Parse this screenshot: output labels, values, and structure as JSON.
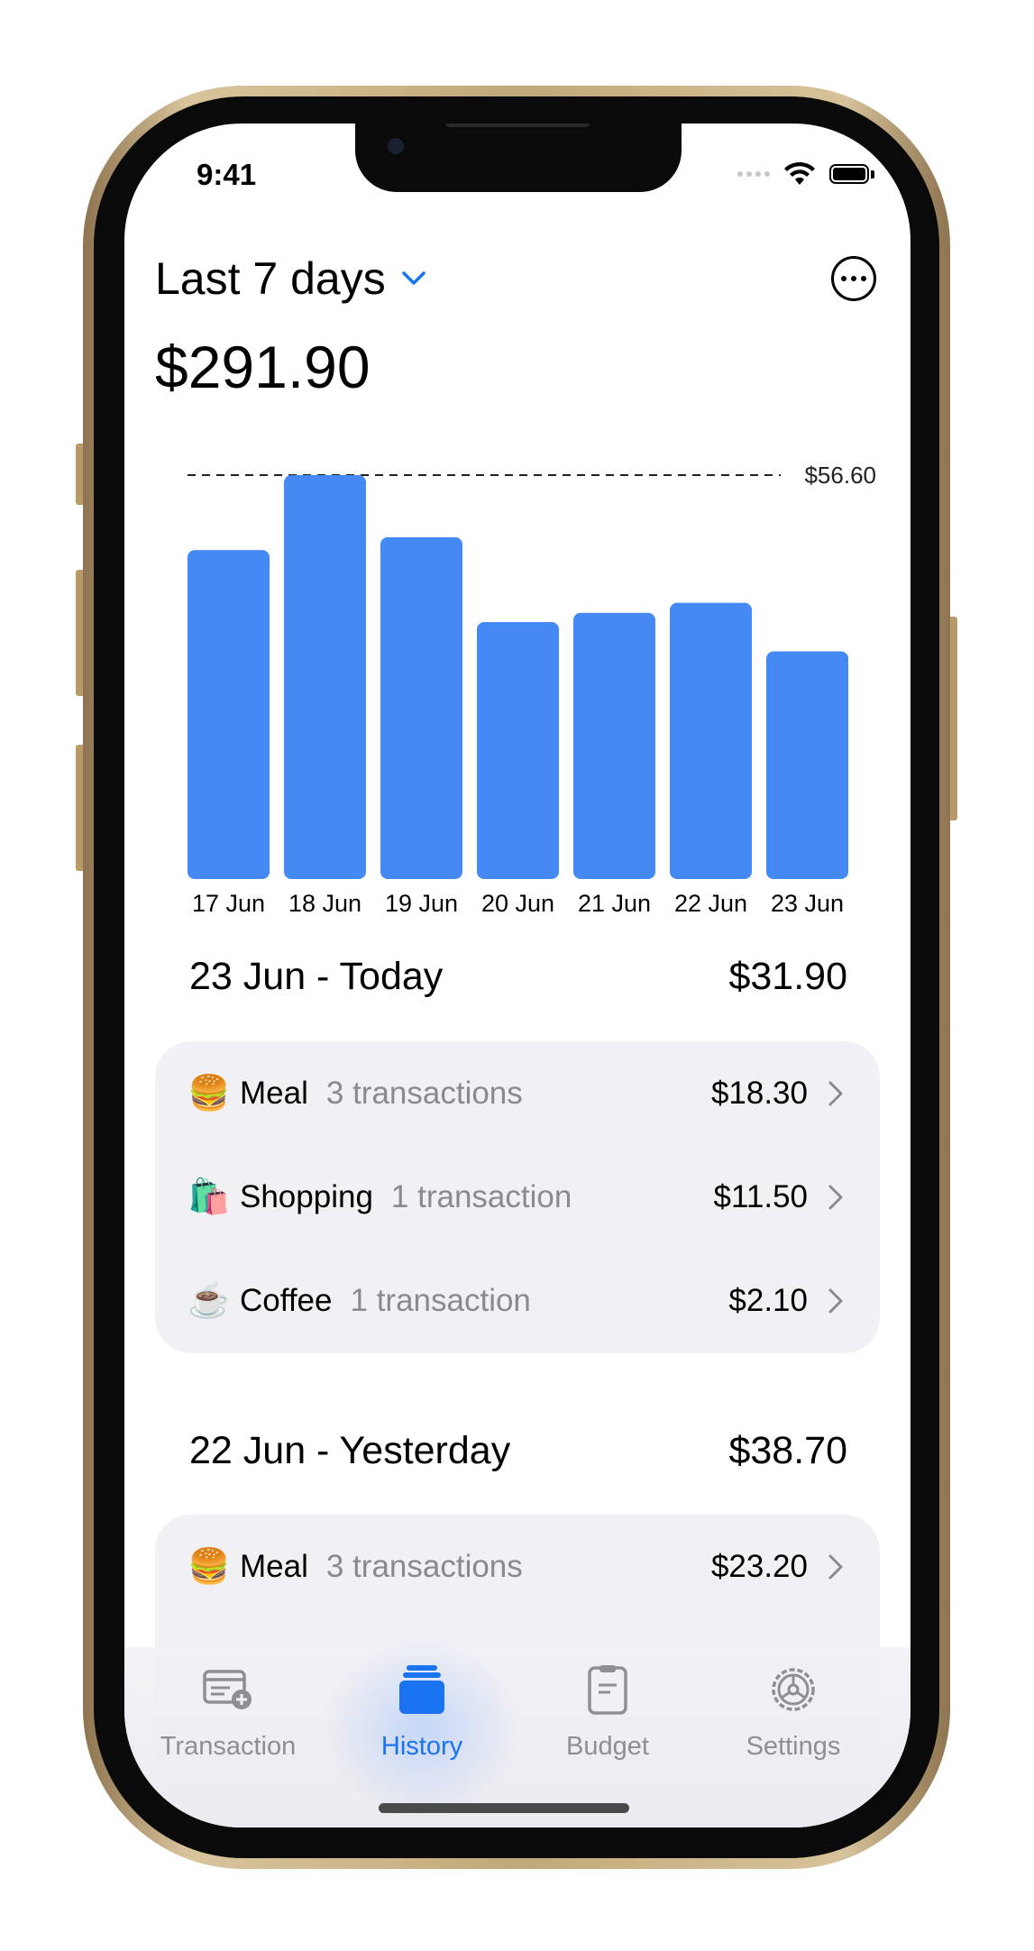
{
  "status_bar": {
    "time": "9:41"
  },
  "header": {
    "period_label": "Last 7 days",
    "total": "$291.90"
  },
  "chart_data": {
    "type": "bar",
    "categories": [
      "17 Jun",
      "18 Jun",
      "19 Jun",
      "20 Jun",
      "21 Jun",
      "22 Jun",
      "23 Jun"
    ],
    "values": [
      46.1,
      56.6,
      47.9,
      36.0,
      37.3,
      38.7,
      31.9
    ],
    "reference_line": {
      "value": 56.6,
      "label": "$56.60"
    },
    "ylim": [
      0,
      56.6
    ],
    "bar_color": "#4589f5",
    "grid": false
  },
  "sections": [
    {
      "title": "23 Jun - Today",
      "total": "$31.90",
      "rows": [
        {
          "emoji": "🍔",
          "name": "Meal",
          "count": "3 transactions",
          "amount": "$18.30"
        },
        {
          "emoji": "🛍️",
          "name": "Shopping",
          "count": "1 transaction",
          "amount": "$11.50"
        },
        {
          "emoji": "☕",
          "name": "Coffee",
          "count": "1 transaction",
          "amount": "$2.10"
        }
      ]
    },
    {
      "title": "22 Jun - Yesterday",
      "total": "$38.70",
      "rows": [
        {
          "emoji": "🍔",
          "name": "Meal",
          "count": "3 transactions",
          "amount": "$23.20"
        }
      ]
    }
  ],
  "tabs": [
    {
      "label": "Transaction",
      "icon": "transaction-add-icon",
      "active": false
    },
    {
      "label": "History",
      "icon": "history-stack-icon",
      "active": true
    },
    {
      "label": "Budget",
      "icon": "budget-clipboard-icon",
      "active": false
    },
    {
      "label": "Settings",
      "icon": "settings-gear-icon",
      "active": false
    }
  ],
  "colors": {
    "accent": "#1a73f0",
    "bar": "#4589f5",
    "card_background": "#f1f0f5",
    "secondary_text": "#8a8a8e"
  }
}
